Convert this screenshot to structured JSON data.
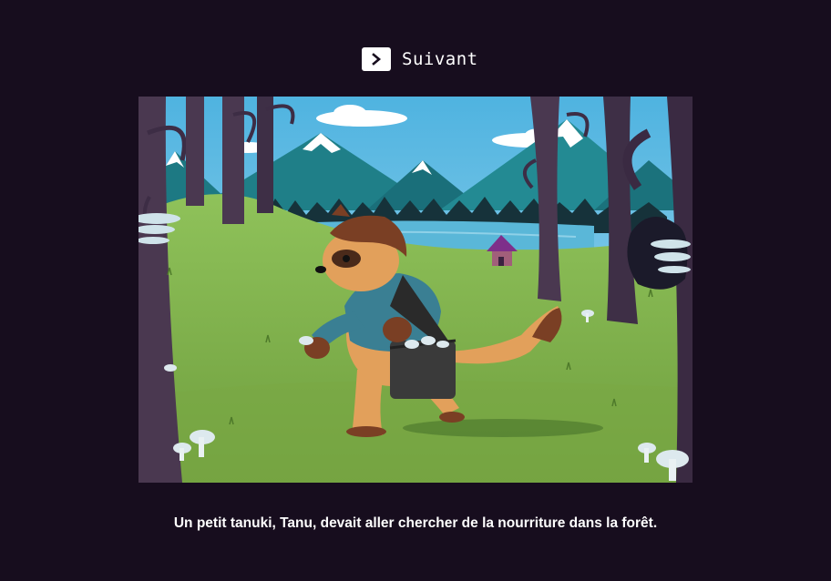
{
  "navigation": {
    "next_label": "Suivant",
    "next_icon": "chevron-right-icon"
  },
  "story": {
    "caption": "Un petit tanuki, Tanu, devait aller chercher de la nourriture dans la forêt."
  },
  "colors": {
    "background": "#170d1e",
    "button": "#ffffff",
    "text": "#ffffff"
  }
}
